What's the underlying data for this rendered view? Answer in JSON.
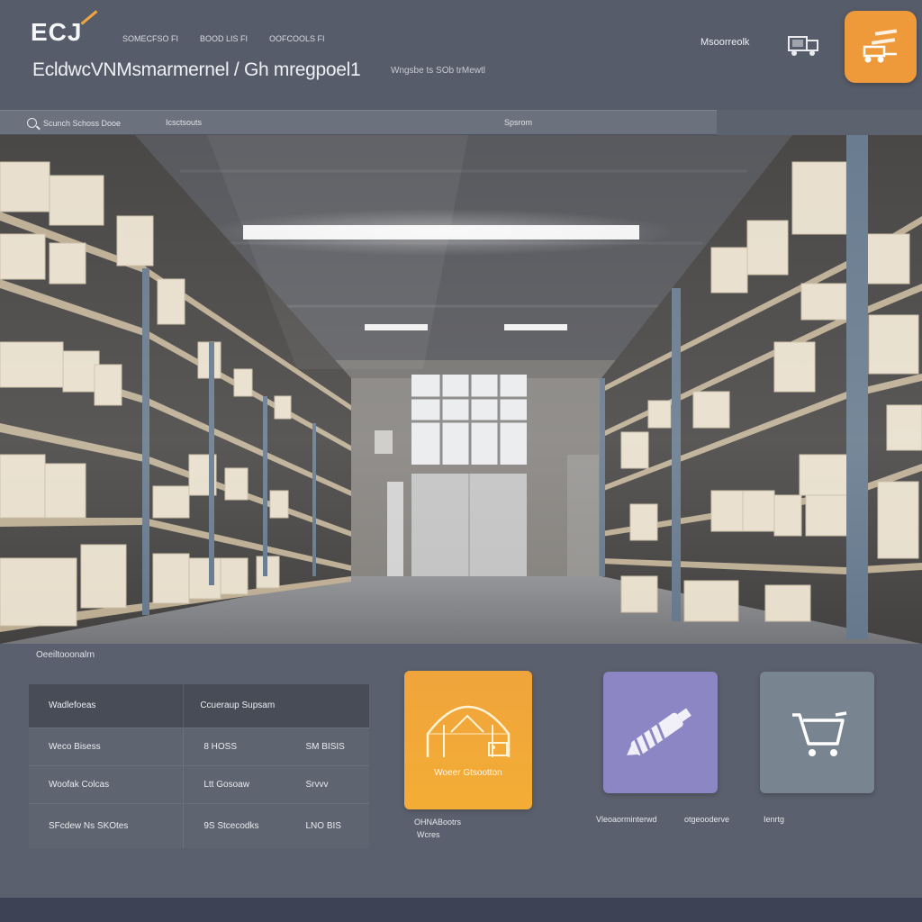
{
  "header": {
    "logo": "ECJ",
    "nav": [
      "SOMECFSO FI",
      "BOOD LIS FI",
      "OOFCOOLS FI"
    ],
    "title": "EcldwcVNMsmarmernel / Gh mregpoel1",
    "subtitle": "Wngsbe ts SOb trMewtl",
    "account_label": "Msoorreolk",
    "truck_icon": "truck-icon",
    "action_icon": "forklift-icon",
    "accent_color": "#ef9a3a"
  },
  "search": {
    "placeholder": "Scunch Schoss Dooe",
    "filter_label": "Icsctsouts",
    "button_label": "Spsrom"
  },
  "section": {
    "label": "Oeeiltooonalrn"
  },
  "table": {
    "headers": [
      "Wadlefoeas",
      "Ccueraup Supsam"
    ],
    "rows": [
      [
        "Weco Bisess",
        "8 HOSS",
        "SM BISIS"
      ],
      [
        "Woofak Colcas",
        "Ltt Gosoaw",
        "Srvvv"
      ],
      [
        "SFcdew Ns SKOtes",
        "9S Stcecodks",
        "LNO BIS"
      ]
    ]
  },
  "tiles": [
    {
      "name": "warehouse",
      "caption": "Woeer Gtsootton",
      "label_line1": "OHNABootrs",
      "label_line2": "Wcres",
      "icon": "warehouse-icon",
      "color": "#f0a43c"
    },
    {
      "name": "tools",
      "label": "Vleoaorminterwd",
      "icon": "drill-icon",
      "color": "#8c86c4"
    },
    {
      "name": "cart",
      "label": "otgeooderve",
      "icon": "cart-icon",
      "color": "#788591"
    }
  ],
  "extra_labels": {
    "cart_side_label": "Ienrtg"
  }
}
